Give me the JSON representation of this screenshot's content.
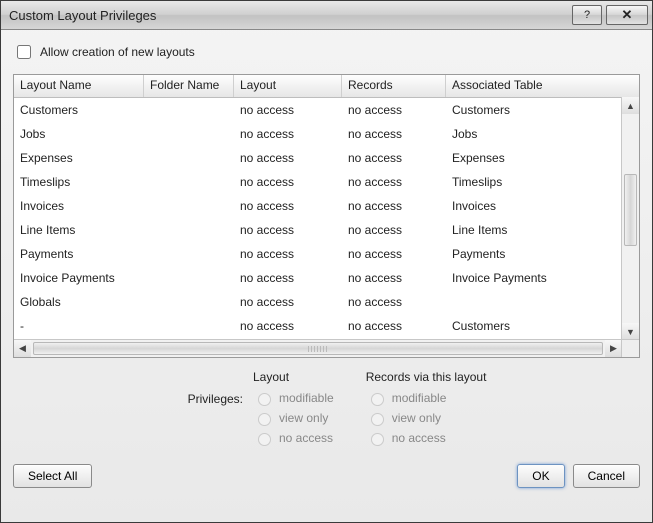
{
  "window": {
    "title": "Custom Layout Privileges"
  },
  "options": {
    "allow_creation_label": "Allow creation of new layouts",
    "allow_creation_checked": false
  },
  "table": {
    "columns": {
      "layout_name": "Layout Name",
      "folder_name": "Folder Name",
      "layout": "Layout",
      "records": "Records",
      "associated": "Associated Table"
    },
    "rows": [
      {
        "layout_name": "Customers",
        "folder_name": "",
        "layout": "no access",
        "records": "no access",
        "associated": "Customers"
      },
      {
        "layout_name": "Jobs",
        "folder_name": "",
        "layout": "no access",
        "records": "no access",
        "associated": "Jobs"
      },
      {
        "layout_name": "Expenses",
        "folder_name": "",
        "layout": "no access",
        "records": "no access",
        "associated": "Expenses"
      },
      {
        "layout_name": "Timeslips",
        "folder_name": "",
        "layout": "no access",
        "records": "no access",
        "associated": "Timeslips"
      },
      {
        "layout_name": "Invoices",
        "folder_name": "",
        "layout": "no access",
        "records": "no access",
        "associated": "Invoices"
      },
      {
        "layout_name": "Line Items",
        "folder_name": "",
        "layout": "no access",
        "records": "no access",
        "associated": "Line Items"
      },
      {
        "layout_name": "Payments",
        "folder_name": "",
        "layout": "no access",
        "records": "no access",
        "associated": "Payments"
      },
      {
        "layout_name": "Invoice Payments",
        "folder_name": "",
        "layout": "no access",
        "records": "no access",
        "associated": "Invoice Payments"
      },
      {
        "layout_name": "Globals",
        "folder_name": "",
        "layout": "no access",
        "records": "no access",
        "associated": ""
      },
      {
        "layout_name": "-",
        "folder_name": "",
        "layout": "no access",
        "records": "no access",
        "associated": "Customers"
      }
    ]
  },
  "privileges": {
    "label": "Privileges:",
    "layout": {
      "header": "Layout",
      "options": {
        "modifiable": "modifiable",
        "view_only": "view only",
        "no_access": "no access"
      }
    },
    "records": {
      "header": "Records via this layout",
      "options": {
        "modifiable": "modifiable",
        "view_only": "view only",
        "no_access": "no access"
      }
    }
  },
  "buttons": {
    "select_all": "Select All",
    "ok": "OK",
    "cancel": "Cancel"
  }
}
